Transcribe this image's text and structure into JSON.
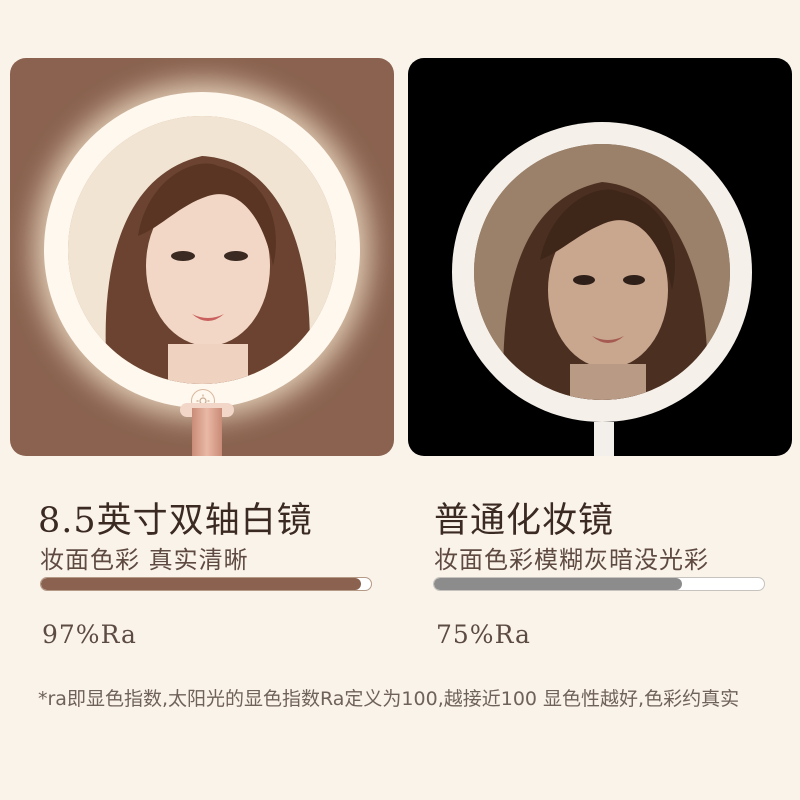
{
  "left": {
    "title": "8.5英寸双轴白镜",
    "subtitle": "妆面色彩 真实清晰",
    "ra_label": "97%Ra",
    "ra_value": 97,
    "bar_color": "#8a624f",
    "panel_color": "#8a624f"
  },
  "right": {
    "title": "普通化妆镜",
    "subtitle": "妆面色彩模糊灰暗没光彩",
    "ra_label": "75%Ra",
    "ra_value": 75,
    "bar_color": "#8c8c8c",
    "panel_color": "#000000"
  },
  "footnote": "*ra即显色指数,太阳光的显色指数Ra定义为100,越接近100 显色性越好,色彩约真实",
  "icons": [
    "touch-sensor-icon"
  ]
}
